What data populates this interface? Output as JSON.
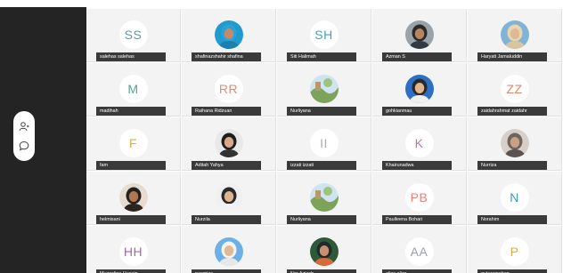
{
  "toolbar": {
    "participants_icon": "participants-icon",
    "chat_icon": "chat-icon"
  },
  "participants": [
    {
      "name": "salehas salehas",
      "initials": "SS",
      "color": "#5a9cae",
      "photo": false
    },
    {
      "name": "shafinazshahir shafina",
      "initials": "",
      "color": "#3a8fbf",
      "photo": true,
      "photo_kind": "hijab-blue"
    },
    {
      "name": "Siti Halimah",
      "initials": "SH",
      "color": "#3aa3c8",
      "photo": false
    },
    {
      "name": "Azman S",
      "initials": "",
      "color": "#6b7a86",
      "photo": true,
      "photo_kind": "man-suit-grey"
    },
    {
      "name": "Haryati Jamaluddin",
      "initials": "",
      "color": "#d9c8a0",
      "photo": true,
      "photo_kind": "hijab-beige"
    },
    {
      "name": "madihah",
      "initials": "M",
      "color": "#4aa58a",
      "photo": false
    },
    {
      "name": "Raihana Ridzuan",
      "initials": "RR",
      "color": "#d2947a",
      "photo": false
    },
    {
      "name": "Nurliyana",
      "initials": "",
      "color": "#9cb07a",
      "photo": true,
      "photo_kind": "landscape"
    },
    {
      "name": "gohkianmau",
      "initials": "",
      "color": "#3a78c8",
      "photo": true,
      "photo_kind": "man-glasses-blue"
    },
    {
      "name": "zaidahrahmat zaidahr",
      "initials": "ZZ",
      "color": "#e0856b",
      "photo": false
    },
    {
      "name": "fam",
      "initials": "F",
      "color": "#e6a83a",
      "photo": false
    },
    {
      "name": "Aditah Yahya",
      "initials": "",
      "color": "#3b3b3b",
      "photo": true,
      "photo_kind": "woman-dark"
    },
    {
      "name": "izzati izzati",
      "initials": "II",
      "color": "#b9a6a6",
      "photo": false
    },
    {
      "name": "Khairunadwa",
      "initials": "K",
      "color": "#b07aa8",
      "photo": false
    },
    {
      "name": "Nurriza",
      "initials": "",
      "color": "#a08f86",
      "photo": true,
      "photo_kind": "hijab-grey"
    },
    {
      "name": "helmisani",
      "initials": "",
      "color": "#6b4a35",
      "photo": true,
      "photo_kind": "man-suit-brown"
    },
    {
      "name": "Nurzila",
      "initials": "",
      "color": "#262626",
      "photo": true,
      "photo_kind": "hijab-white"
    },
    {
      "name": "Nurliyana",
      "initials": "",
      "color": "#9cb07a",
      "photo": true,
      "photo_kind": "landscape"
    },
    {
      "name": "Paulleena Bohari",
      "initials": "PB",
      "color": "#e0857a",
      "photo": false
    },
    {
      "name": "Norahim",
      "initials": "N",
      "color": "#3a9ab8",
      "photo": false
    },
    {
      "name": "Muzzalina Husain",
      "initials": "HH",
      "color": "#a866b0",
      "photo": false
    },
    {
      "name": "nasmiza",
      "initials": "",
      "color": "#4a8fd0",
      "photo": true,
      "photo_kind": "hijab-lightblue"
    },
    {
      "name": "Nor Azizah",
      "initials": "",
      "color": "#3a6b4a",
      "photo": true,
      "photo_kind": "woman-colorful"
    },
    {
      "name": "aliza aliza",
      "initials": "AA",
      "color": "#9aa0a6",
      "photo": false
    },
    {
      "name": "puteramohan",
      "initials": "P",
      "color": "#e6a83a",
      "photo": false
    }
  ]
}
